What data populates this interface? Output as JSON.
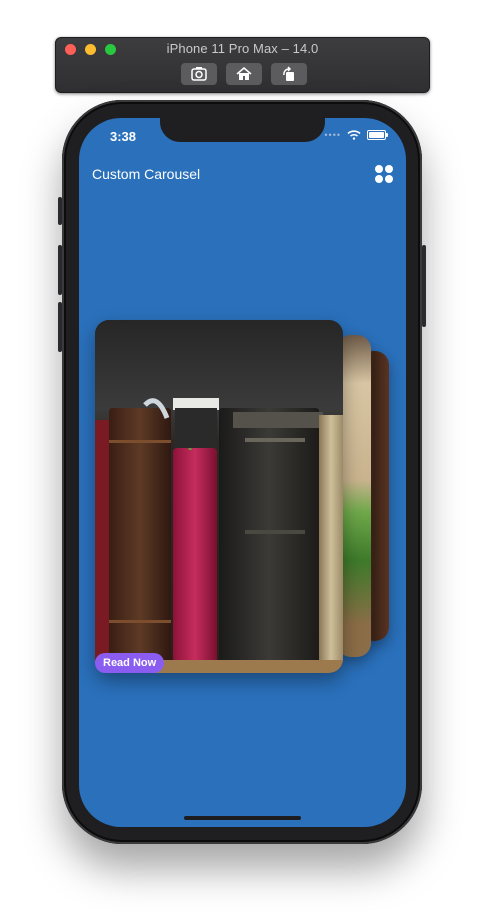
{
  "simulator": {
    "title": "iPhone 11 Pro Max – 14.0",
    "buttons": [
      "screenshot-icon",
      "home-icon",
      "rotate-icon"
    ]
  },
  "status_bar": {
    "time": "3:38",
    "signal_dots": "••••"
  },
  "app": {
    "title": "Custom Carousel",
    "menu_icon": "grid-icon",
    "background_color": "#2a70bb"
  },
  "carousel": {
    "current_card": {
      "image": "old books on shelf",
      "button_label": "Read Now",
      "button_color": "#8a5cf0"
    }
  }
}
